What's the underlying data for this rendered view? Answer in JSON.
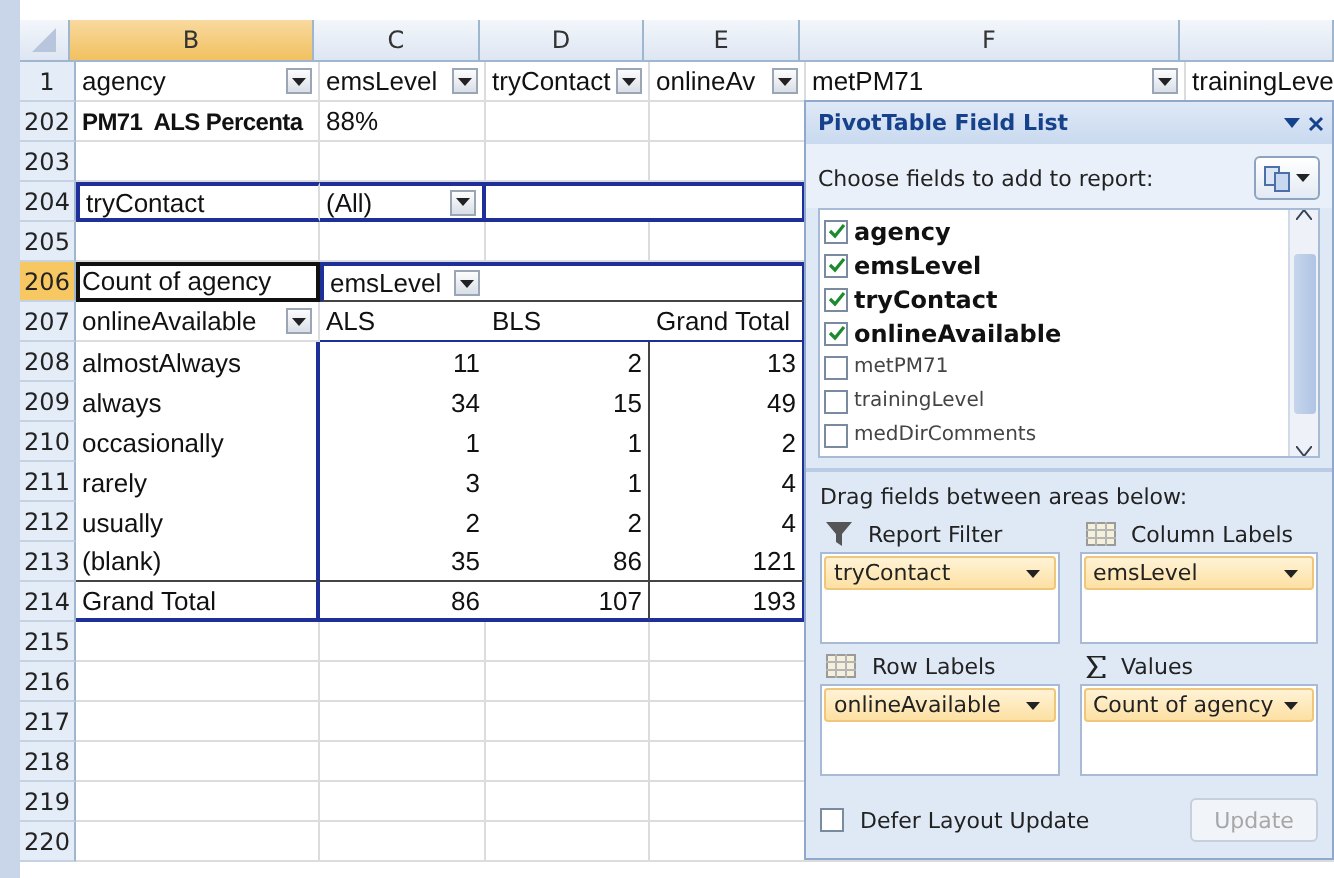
{
  "columns": [
    {
      "kind": "corner",
      "selected": false
    },
    {
      "label": "B",
      "kind": "col",
      "selected": true
    },
    {
      "label": "C",
      "kind": "col",
      "selected": false
    },
    {
      "label": "D",
      "kind": "col",
      "selected": false
    },
    {
      "label": "E",
      "kind": "col",
      "selected": false
    },
    {
      "label": "F",
      "kind": "col",
      "selected": false
    },
    {
      "kind": "col",
      "selected": false
    }
  ],
  "rows": [
    {
      "number": "1",
      "kind": "header",
      "selected": false,
      "cells": [
        {
          "text": "agency",
          "dropdown": true
        },
        {
          "text": "emsLevel",
          "dropdown": true
        },
        {
          "text": "tryContact",
          "dropdown": true
        },
        {
          "text": "onlineAv",
          "dropdown": true
        },
        {
          "text": "metPM71",
          "dropdown": true
        },
        {
          "text": "trainingLeve"
        }
      ]
    },
    {
      "number": "202",
      "kind": "plain",
      "selected": false,
      "cells": [
        {
          "text": "PM71  ALS Percenta",
          "bold": true
        },
        {
          "text": "88%"
        }
      ]
    },
    {
      "number": "203",
      "kind": "plain",
      "selected": false,
      "cells": []
    },
    {
      "number": "204",
      "kind": "filter",
      "selected": false,
      "cells": [
        {
          "text": "tryContact"
        },
        {
          "text": "(All)",
          "dropdown": true
        }
      ]
    },
    {
      "number": "205",
      "kind": "plain",
      "selected": false,
      "cells": []
    },
    {
      "number": "206",
      "kind": "pivot-top",
      "selected": true,
      "cells": [
        {
          "text": "Count of agency",
          "selected": true
        },
        {
          "text": "emsLevel",
          "dropdown": true
        }
      ]
    },
    {
      "number": "207",
      "kind": "pivot-head",
      "selected": false,
      "cells": [
        {
          "text": "onlineAvailable",
          "dropdown": true
        },
        {
          "text": "ALS"
        },
        {
          "text": "BLS"
        },
        {
          "text": "Grand Total"
        }
      ]
    },
    {
      "number": "208",
      "kind": "pivot-data",
      "selected": false,
      "cells": [
        {
          "text": "almostAlways"
        },
        {
          "text": "11"
        },
        {
          "text": "2"
        },
        {
          "text": "13"
        }
      ]
    },
    {
      "number": "209",
      "kind": "pivot-data",
      "selected": false,
      "cells": [
        {
          "text": "always"
        },
        {
          "text": "34"
        },
        {
          "text": "15"
        },
        {
          "text": "49"
        }
      ]
    },
    {
      "number": "210",
      "kind": "pivot-data",
      "selected": false,
      "cells": [
        {
          "text": "occasionally"
        },
        {
          "text": "1"
        },
        {
          "text": "1"
        },
        {
          "text": "2"
        }
      ]
    },
    {
      "number": "211",
      "kind": "pivot-data",
      "selected": false,
      "cells": [
        {
          "text": "rarely"
        },
        {
          "text": "3"
        },
        {
          "text": "1"
        },
        {
          "text": "4"
        }
      ]
    },
    {
      "number": "212",
      "kind": "pivot-data",
      "selected": false,
      "cells": [
        {
          "text": "usually"
        },
        {
          "text": "2"
        },
        {
          "text": "2"
        },
        {
          "text": "4"
        }
      ]
    },
    {
      "number": "213",
      "kind": "pivot-last",
      "selected": false,
      "cells": [
        {
          "text": "(blank)"
        },
        {
          "text": "35"
        },
        {
          "text": "86"
        },
        {
          "text": "121"
        }
      ]
    },
    {
      "number": "214",
      "kind": "pivot-total",
      "selected": false,
      "cells": [
        {
          "text": "Grand Total"
        },
        {
          "text": "86"
        },
        {
          "text": "107"
        },
        {
          "text": "193"
        }
      ]
    },
    {
      "number": "215",
      "kind": "plain",
      "selected": false,
      "cells": []
    },
    {
      "number": "216",
      "kind": "plain",
      "selected": false,
      "cells": []
    },
    {
      "number": "217",
      "kind": "plain",
      "selected": false,
      "cells": []
    },
    {
      "number": "218",
      "kind": "plain",
      "selected": false,
      "cells": []
    },
    {
      "number": "219",
      "kind": "plain",
      "selected": false,
      "cells": []
    },
    {
      "number": "220",
      "kind": "plain",
      "selected": false,
      "cells": []
    }
  ],
  "field_list": {
    "title": "PivotTable Field List",
    "prompt": "Choose fields to add to report:",
    "fields": [
      {
        "label": "agency",
        "checked": true
      },
      {
        "label": "emsLevel",
        "checked": true
      },
      {
        "label": "tryContact",
        "checked": true
      },
      {
        "label": "onlineAvailable",
        "checked": true
      },
      {
        "label": "metPM71",
        "checked": false
      },
      {
        "label": "trainingLevel",
        "checked": false
      },
      {
        "label": "medDirComments",
        "checked": false
      }
    ],
    "areas_prompt": "Drag fields between areas below:",
    "areas": [
      {
        "kind": "filter",
        "label": "Report Filter",
        "field": "tryContact"
      },
      {
        "kind": "columns",
        "label": "Column Labels",
        "field": "emsLevel"
      },
      {
        "kind": "rows",
        "label": "Row Labels",
        "field": "onlineAvailable"
      },
      {
        "kind": "values",
        "label": "Values",
        "field": "Count of agency"
      }
    ],
    "defer": {
      "label": "Defer Layout Update",
      "checked": false
    },
    "update": {
      "label": "Update",
      "disabled": true
    }
  }
}
